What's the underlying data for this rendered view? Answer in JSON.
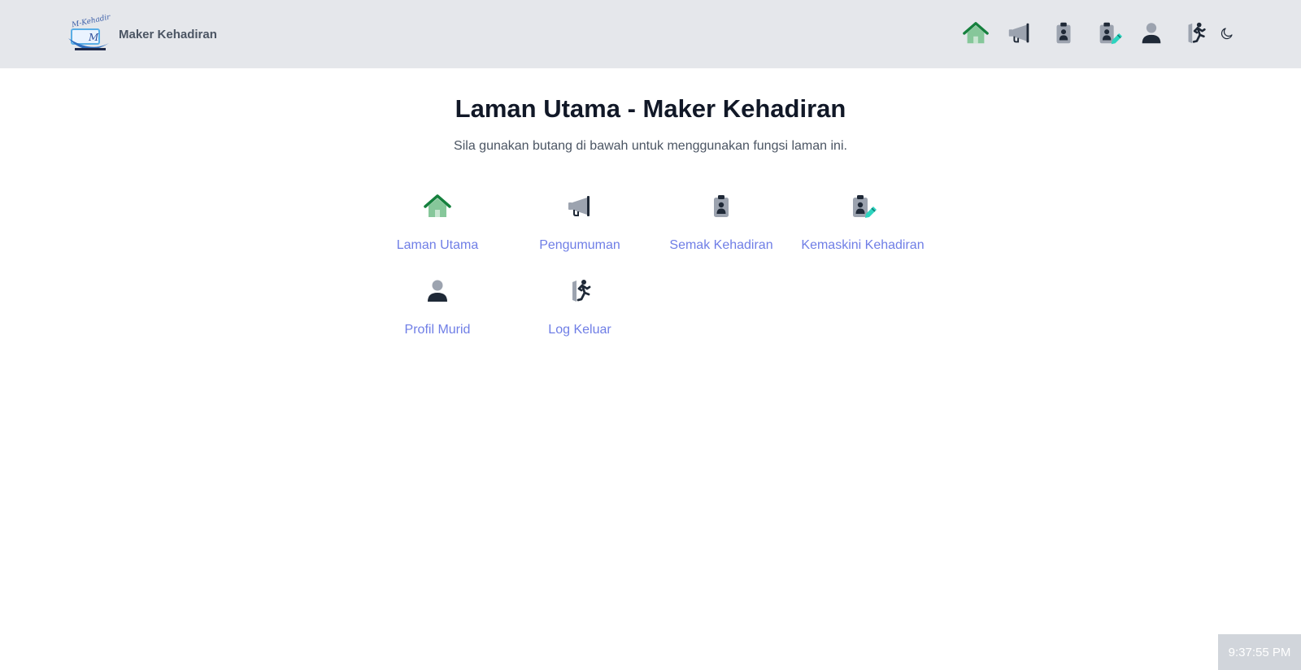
{
  "brand": {
    "logo_text": "M-Kehadiran",
    "logo_letter": "M",
    "name": "Maker Kehadiran"
  },
  "nav": {
    "items": [
      {
        "icon": "home-icon",
        "label": "Laman Utama"
      },
      {
        "icon": "megaphone-icon",
        "label": "Pengumuman"
      },
      {
        "icon": "clipboard-user-icon",
        "label": "Semak Kehadiran"
      },
      {
        "icon": "clipboard-edit-icon",
        "label": "Kemaskini Kehadiran"
      },
      {
        "icon": "user-icon",
        "label": "Profil Murid"
      },
      {
        "icon": "logout-run-icon",
        "label": "Log Keluar"
      }
    ],
    "theme_toggle_icon": "moon-icon"
  },
  "main": {
    "title": "Laman Utama - Maker Kehadiran",
    "subtitle": "Sila gunakan butang di bawah untuk menggunakan fungsi laman ini.",
    "menu": [
      {
        "icon": "home-icon",
        "label": "Laman Utama"
      },
      {
        "icon": "megaphone-icon",
        "label": "Pengumuman"
      },
      {
        "icon": "clipboard-user-icon",
        "label": "Semak Kehadiran"
      },
      {
        "icon": "clipboard-edit-icon",
        "label": "Kemaskini Kehadiran"
      },
      {
        "icon": "user-icon",
        "label": "Profil Murid"
      },
      {
        "icon": "logout-run-icon",
        "label": "Log Keluar"
      }
    ]
  },
  "clock": {
    "time": "9:37:55 PM"
  },
  "colors": {
    "navbar_bg": "#e5e7eb",
    "link": "#6f7ee6",
    "home_green": "#15803d",
    "home_light": "#86c79a",
    "icon_dark": "#1f2937",
    "icon_gray": "#9ca3af",
    "pencil_teal": "#2dd4bf"
  }
}
